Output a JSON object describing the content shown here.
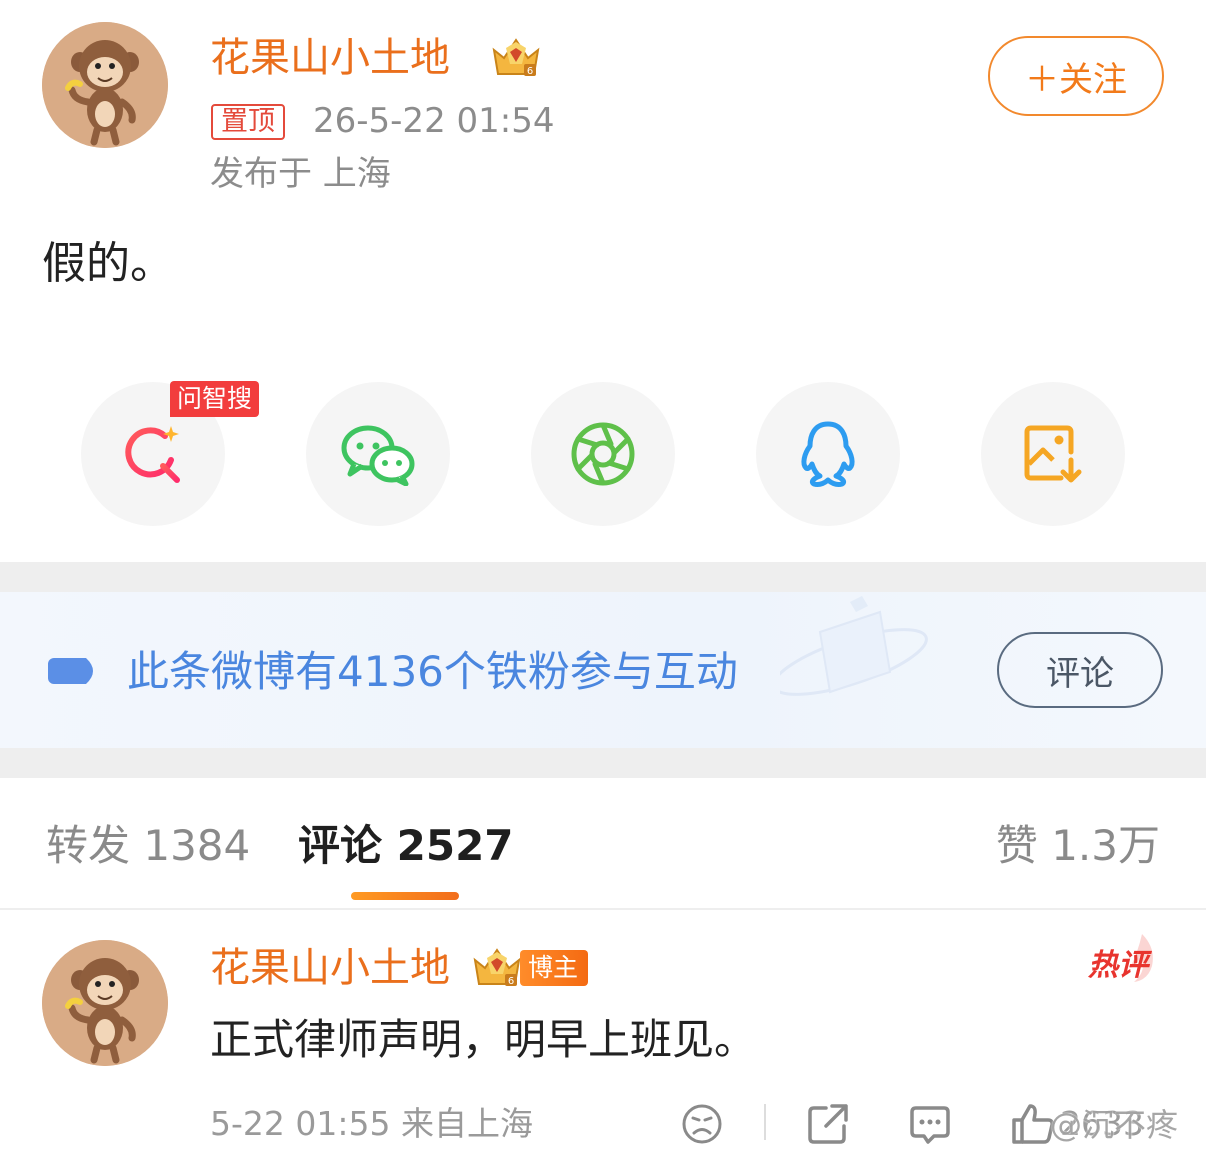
{
  "post": {
    "username": "花果山小土地",
    "pin_label": "置顶",
    "time": "26-5-22 01:54",
    "location": "发布于 上海",
    "follow_label": "＋关注",
    "content": "假的。"
  },
  "share": {
    "ask_badge": "问智搜",
    "items": [
      "search-icon",
      "wechat-icon",
      "moments-icon",
      "qq-icon",
      "save-image-icon"
    ]
  },
  "fans_banner": {
    "text": "此条微博有4136个铁粉参与互动",
    "comment_button": "评论"
  },
  "tabs": {
    "repost": "转发 1384",
    "comments": "评论 2527",
    "likes": "赞 1.3万"
  },
  "comment": {
    "username": "花果山小土地",
    "author_badge": "博主",
    "hot_label": "热评",
    "text": "正式律师声明，明早上班见。",
    "time": "5-22 01:55  来自上海",
    "like_count": "2633"
  },
  "watermark": "@沉不疼",
  "colors": {
    "accent_orange": "#ea6f1c",
    "link_blue": "#4a86df",
    "pin_red": "#e44a3b",
    "wechat_green": "#3ec460",
    "qq_blue": "#2d9cf0",
    "save_orange": "#f5a623"
  }
}
